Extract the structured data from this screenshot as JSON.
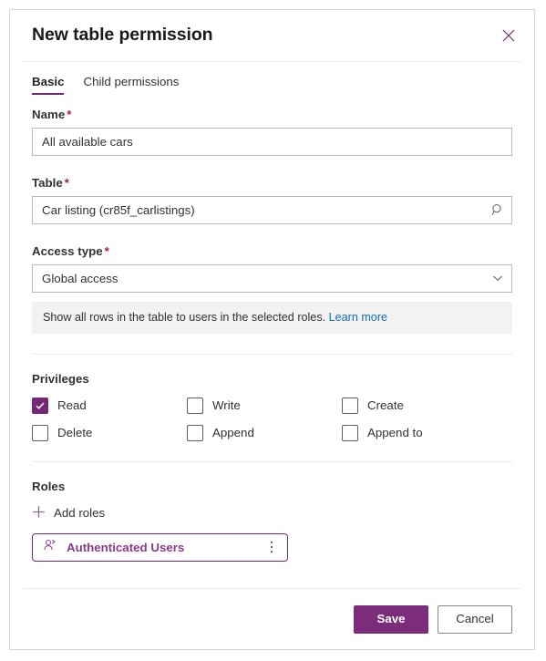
{
  "dialog": {
    "title": "New table permission",
    "close_label": "Close"
  },
  "tabs": [
    {
      "label": "Basic",
      "active": true
    },
    {
      "label": "Child permissions",
      "active": false
    }
  ],
  "fields": {
    "name": {
      "label": "Name",
      "required_marker": "*",
      "value": "All available cars",
      "placeholder": ""
    },
    "table": {
      "label": "Table",
      "required_marker": "*",
      "value": "Car listing (cr85f_carlistings)",
      "placeholder": "",
      "affix_icon": "search-icon"
    },
    "access_type": {
      "label": "Access type",
      "required_marker": "*",
      "value": "Global access",
      "affix_icon": "chevron-down-icon",
      "help_text": "Show all rows in the table to users in the selected roles.",
      "help_link": "Learn more"
    }
  },
  "privileges": {
    "title": "Privileges",
    "items": [
      {
        "label": "Read",
        "checked": true
      },
      {
        "label": "Write",
        "checked": false
      },
      {
        "label": "Create",
        "checked": false
      },
      {
        "label": "Delete",
        "checked": false
      },
      {
        "label": "Append",
        "checked": false
      },
      {
        "label": "Append to",
        "checked": false
      }
    ]
  },
  "roles": {
    "title": "Roles",
    "add_label": "Add roles",
    "add_icon": "plus-icon",
    "chips": [
      {
        "label": "Authenticated Users",
        "icon": "person-icon",
        "menu_icon": "more-vertical-icon"
      }
    ]
  },
  "footer": {
    "save_label": "Save",
    "cancel_label": "Cancel"
  },
  "colors": {
    "accent": "#742774",
    "primary_button": "#7b2d7b",
    "required": "#a4262c",
    "link": "#0f6cbd",
    "banner_bg": "#f3f2f1"
  }
}
